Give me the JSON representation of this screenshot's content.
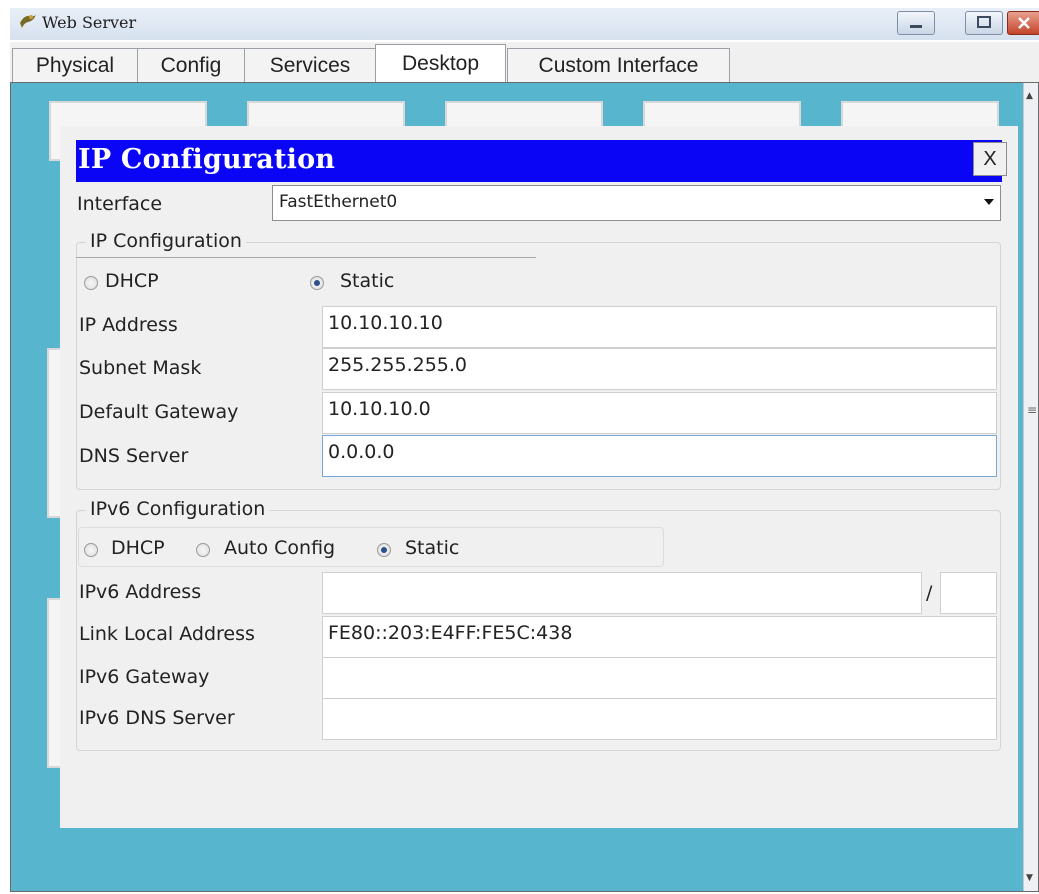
{
  "window": {
    "title": "Web Server"
  },
  "tabs": [
    {
      "label": "Physical"
    },
    {
      "label": "Config"
    },
    {
      "label": "Services"
    },
    {
      "label": "Desktop"
    },
    {
      "label": "Custom Interface"
    }
  ],
  "dialog": {
    "title": "IP Configuration",
    "close_label": "X",
    "interface_label": "Interface",
    "interface_value": "FastEthernet0",
    "ipv4": {
      "legend": "IP Configuration",
      "dhcp_label": "DHCP",
      "static_label": "Static",
      "selected": "Static",
      "ip_address_label": "IP Address",
      "ip_address": "10.10.10.10",
      "subnet_mask_label": "Subnet Mask",
      "subnet_mask": "255.255.255.0",
      "gateway_label": "Default Gateway",
      "gateway": "10.10.10.0",
      "dns_label": "DNS Server",
      "dns": "0.0.0.0"
    },
    "ipv6": {
      "legend": "IPv6 Configuration",
      "dhcp_label": "DHCP",
      "auto_label": "Auto Config",
      "static_label": "Static",
      "selected": "Static",
      "address_label": "IPv6 Address",
      "address": "",
      "prefix_separator": "/",
      "prefix": "",
      "link_local_label": "Link Local Address",
      "link_local": "FE80::203:E4FF:FE5C:438",
      "gateway_label": "IPv6 Gateway",
      "gateway": "",
      "dns_label": "IPv6 DNS Server",
      "dns": ""
    }
  },
  "colors": {
    "dialog_title_bg": "#0a05f5",
    "desktop_bg": "#57b6cd"
  }
}
